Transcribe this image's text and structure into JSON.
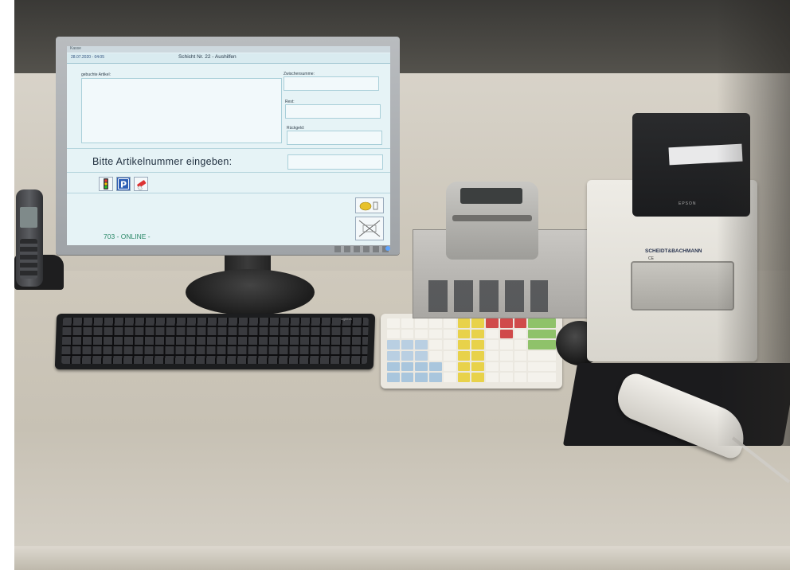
{
  "pos_screen": {
    "window_title": "Kasse",
    "date_time": "28.07.2020 - 04:05",
    "shift": "Schicht Nr. 22 - Aushilfen",
    "labels": {
      "booked_items": "gebuchte Artikel:",
      "subtotal": "Zwischensumme:",
      "remainder": "Rest:",
      "change": "Rückgeld:"
    },
    "prompt": "Bitte  Artikelnummer eingeben:",
    "status": "703 - ONLINE -",
    "icons": [
      "traffic-light-icon",
      "parking-icon",
      "eraser-icon",
      "coin-icon",
      "cancel-icon"
    ]
  },
  "devices": {
    "keyboard_brand": "logitech",
    "printer_brand": "EPSON",
    "reader_brand": "SCHEIDT&BACHMANN",
    "reader_mark": "CE"
  },
  "colors": {
    "screen_bg": "#e6f3f6",
    "online_green": "#2d8a6a",
    "key_blue": "#a9c6dd",
    "key_yellow": "#e8d24a",
    "key_red": "#d04a4a",
    "key_green": "#8fc26a"
  }
}
